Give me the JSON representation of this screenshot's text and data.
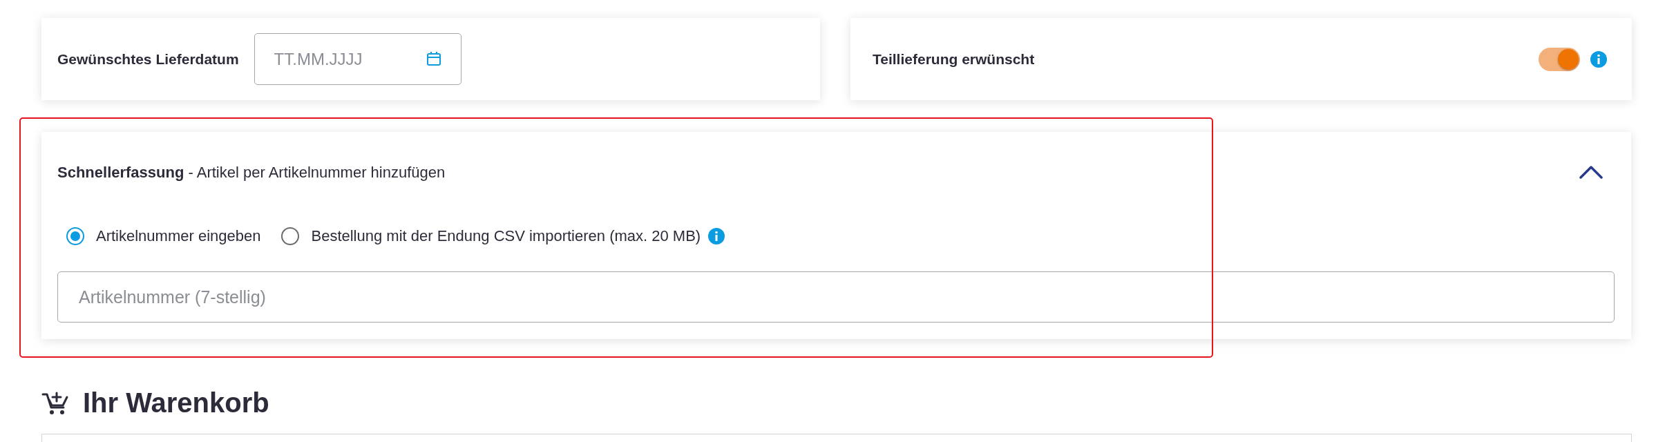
{
  "delivery_date": {
    "label": "Gewünschtes Lieferdatum",
    "placeholder": "TT.MM.JJJJ"
  },
  "partial_delivery": {
    "label": "Teillieferung erwünscht",
    "on": true
  },
  "quick_entry": {
    "title": "**Schnellerfassung** - Artikel per Artikelnummer hinzufügen",
    "expanded": true,
    "highlighted": true,
    "options": [
      {
        "label": "Artikelnummer eingeben",
        "selected": true
      },
      {
        "label": "Bestellung mit der Endung CSV importieren (max. 20 MB)",
        "selected": false
      }
    ],
    "placeholder": "Artikelnummer (7-stellig)"
  },
  "cart": {
    "title": "Ihr Warenkorb"
  }
}
